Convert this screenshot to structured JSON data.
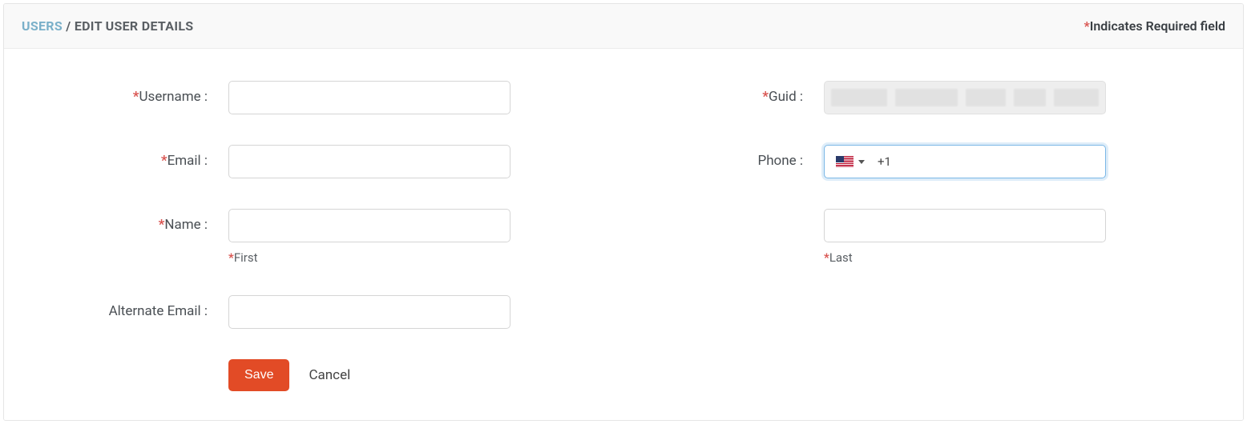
{
  "breadcrumb": {
    "root": "USERS",
    "sep": "/",
    "current": "EDIT USER DETAILS"
  },
  "requiredNote": "Indicates Required field",
  "labels": {
    "username": "Username :",
    "guid": "Guid :",
    "email": "Email :",
    "phone": "Phone :",
    "name": "Name :",
    "altEmail": "Alternate Email :"
  },
  "sublabels": {
    "first": "First",
    "last": "Last"
  },
  "phone": {
    "dial": "+1",
    "value": ""
  },
  "values": {
    "username": "",
    "email": "",
    "first": "",
    "last": "",
    "altEmail": ""
  },
  "buttons": {
    "save": "Save",
    "cancel": "Cancel"
  }
}
